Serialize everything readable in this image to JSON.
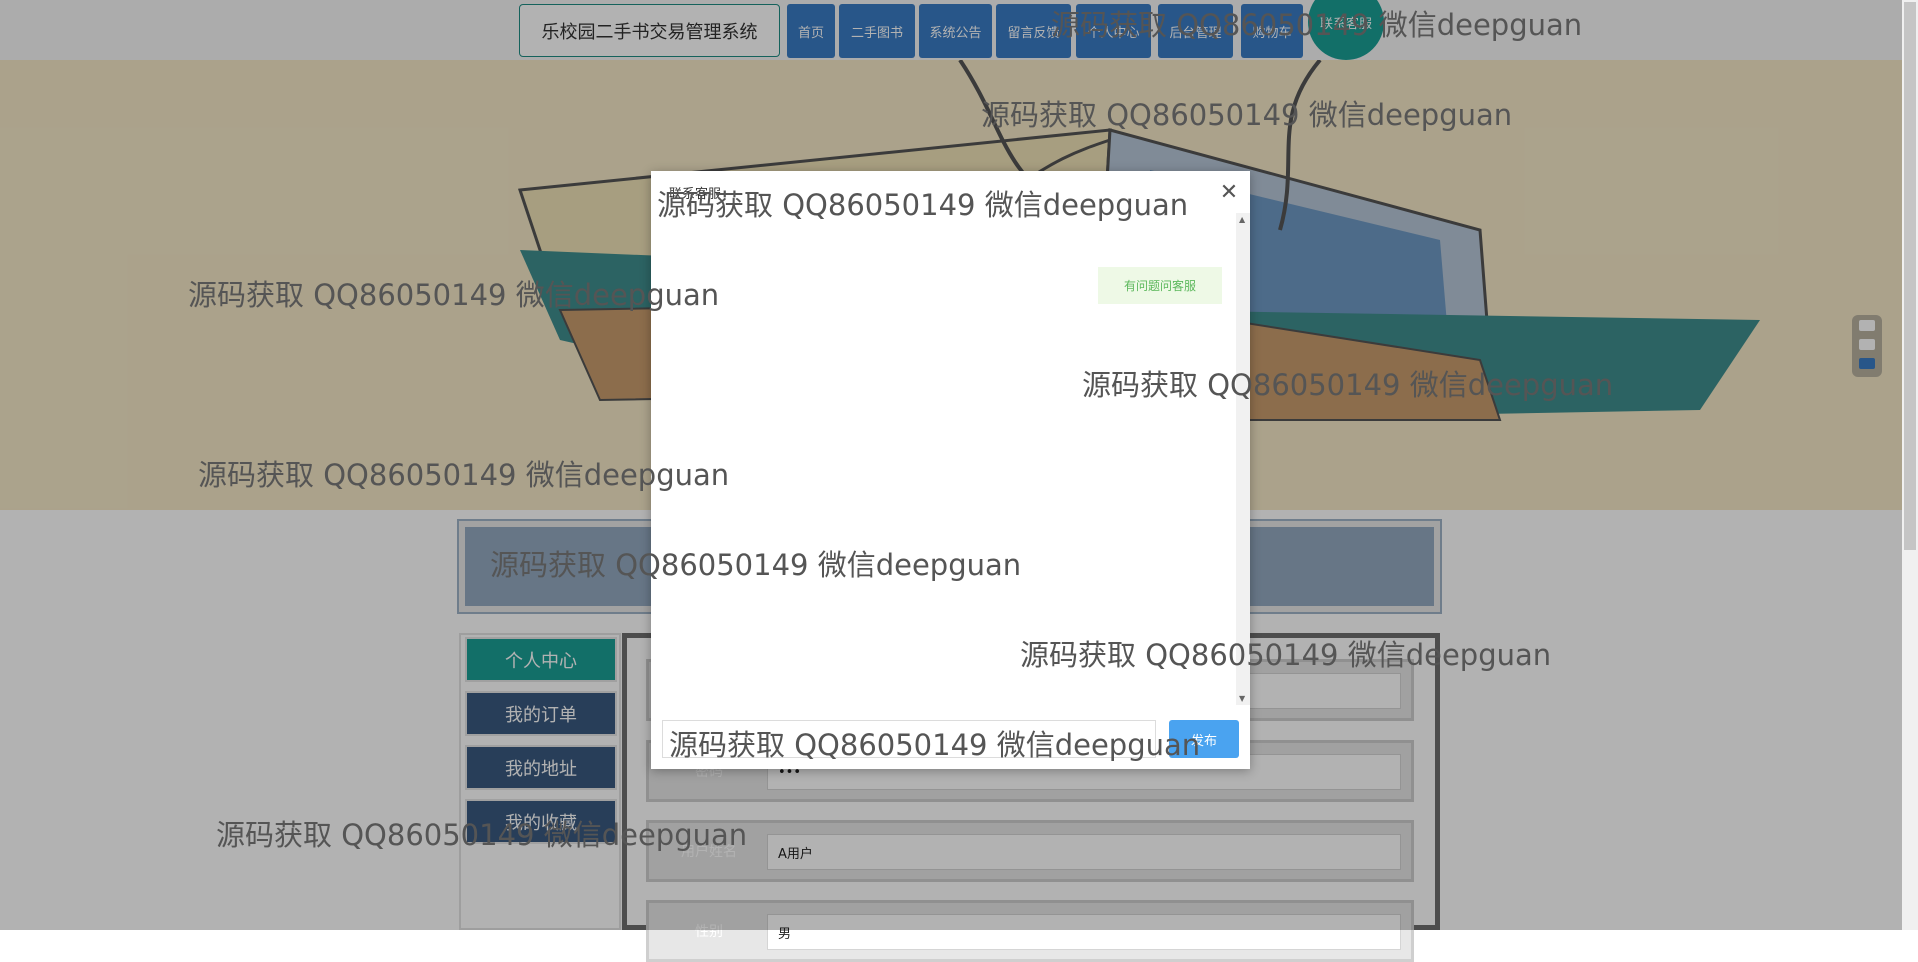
{
  "header": {
    "site_title": "乐校园二手书交易管理系统",
    "nav": [
      "首页",
      "二手图书",
      "系统公告",
      "留言反馈",
      "个人中心",
      "后台管理",
      "购物车"
    ],
    "kefu_label": "联系客服"
  },
  "side_menu": [
    "个人中心",
    "我的订单",
    "我的地址",
    "我的收藏"
  ],
  "form": {
    "password_label": "密码",
    "password_value": "•••",
    "name_label": "用户姓名",
    "name_value": "A用户",
    "gender_label": "性别",
    "gender_value": "男"
  },
  "dialog": {
    "title": "联系客服",
    "close_icon": "close-icon",
    "bubble": "有问题问客服",
    "send_label": "发布",
    "input_placeholder": ""
  },
  "watermark": "源码获取 QQ86050149 微信deepguan",
  "colors": {
    "nav_blue": "#3a7cc4",
    "teal": "#1b9f96",
    "menu_active": "#1b9f96",
    "menu_normal": "#3a5a80",
    "send_blue": "#4aa3f0",
    "bubble_green": "#5cb85c"
  }
}
